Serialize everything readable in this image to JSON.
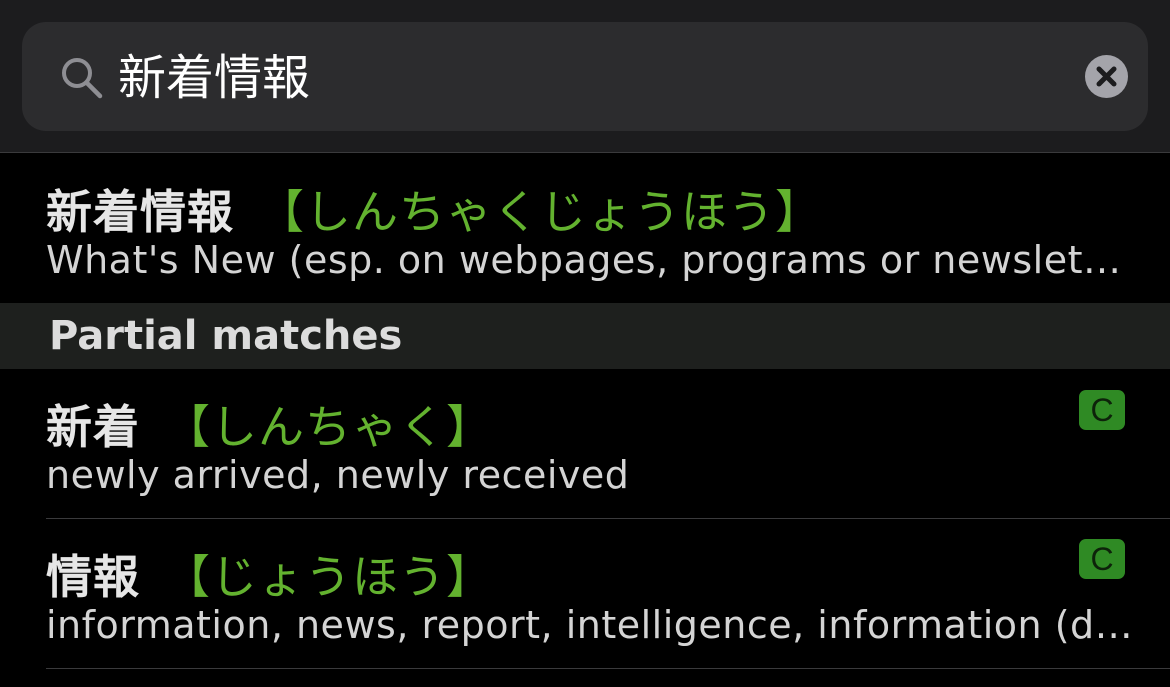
{
  "search": {
    "query": "新着情報"
  },
  "exact_match": {
    "word": "新着情報",
    "reading": "【しんちゃくじょうほう】",
    "definition": "What's New (esp. on webpages, programs or newsletters)"
  },
  "partial_section": {
    "title": "Partial matches",
    "items": [
      {
        "word": "新着",
        "reading": "【しんちゃく】",
        "definition": "newly arrived, newly received",
        "badge": "C"
      },
      {
        "word": "情報",
        "reading": "【じょうほう】",
        "definition": "information, news, report, intelligence, information (data contained in characters, signals, code, etc.)",
        "badge": "C"
      }
    ]
  },
  "colors": {
    "reading_green": "#63b22f",
    "badge_green": "#2f8a24",
    "background": "#000000"
  },
  "icons": {
    "search": "magnifying-glass-icon",
    "clear": "circled-x-icon"
  }
}
